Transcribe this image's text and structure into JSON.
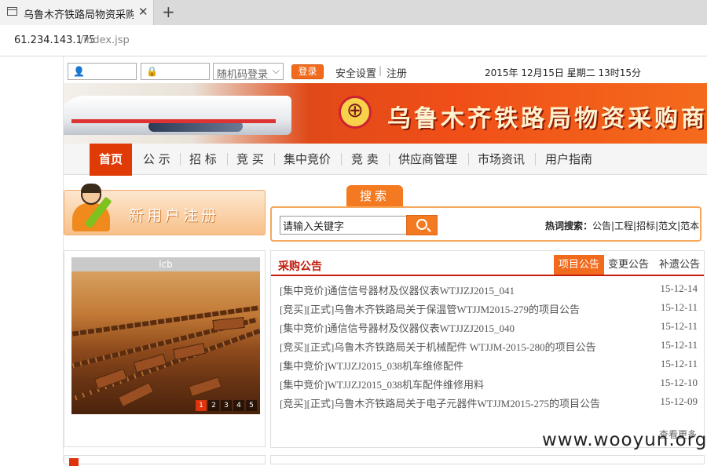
{
  "browser": {
    "tab_title": "乌鲁木齐铁路局物资采购",
    "close_symbol": "✕",
    "new_tab_symbol": "+",
    "url_host": "61.234.143.175",
    "url_path": "/index.jsp"
  },
  "login": {
    "username_icon": "user-icon",
    "password_icon": "lock-icon",
    "login_mode": "随机码登录",
    "login_button": "登录",
    "settings_link": "安全设置",
    "separator": "|",
    "register_link": "注册",
    "datetime": "2015年 12月15日  星期二  13时15分"
  },
  "banner": {
    "title": "乌鲁木齐铁路局物资采购商务平台"
  },
  "nav": {
    "items": [
      "首页",
      "公 示",
      "招 标",
      "竞 买",
      "集中竞价",
      "竞 卖",
      "供应商管理",
      "市场资讯",
      "用户指南"
    ]
  },
  "register": {
    "label": "新用户注册"
  },
  "search": {
    "tab_label": "搜索",
    "input_value": "请输入关键字",
    "hot_label": "热词搜索：",
    "hot_words": "公告|工程|招标|范文|范本"
  },
  "photo": {
    "caption": "lcb",
    "pages": [
      "1",
      "2",
      "3",
      "4",
      "5"
    ]
  },
  "announcements": {
    "title": "采购公告",
    "tabs": [
      "项目公告",
      "变更公告",
      "补遗公告"
    ],
    "rows": [
      {
        "title": "[集中竞价]通信信号器材及仪器仪表WTJJZJ2015_041",
        "date": "15-12-14"
      },
      {
        "title": "[竞买][正式]乌鲁木齐铁路局关于保温管WTJJM2015-279的项目公告",
        "date": "15-12-11"
      },
      {
        "title": "[集中竞价]通信信号器材及仪器仪表WTJJZJ2015_040",
        "date": "15-12-11"
      },
      {
        "title": "[竞买][正式]乌鲁木齐铁路局关于机械配件 WTJJM-2015-280的项目公告",
        "date": "15-12-11"
      },
      {
        "title": "[集中竞价]WTJJZJ2015_038机车维修配件",
        "date": "15-12-11"
      },
      {
        "title": "[集中竞价]WTJJZJ2015_038机车配件维修用料",
        "date": "15-12-10"
      },
      {
        "title": "[竞买][正式]乌鲁木齐铁路局关于电子元器件WTJJM2015-275的项目公告",
        "date": "15-12-09"
      }
    ],
    "more": "查看更多"
  },
  "watermark": "www.wooyun.org"
}
